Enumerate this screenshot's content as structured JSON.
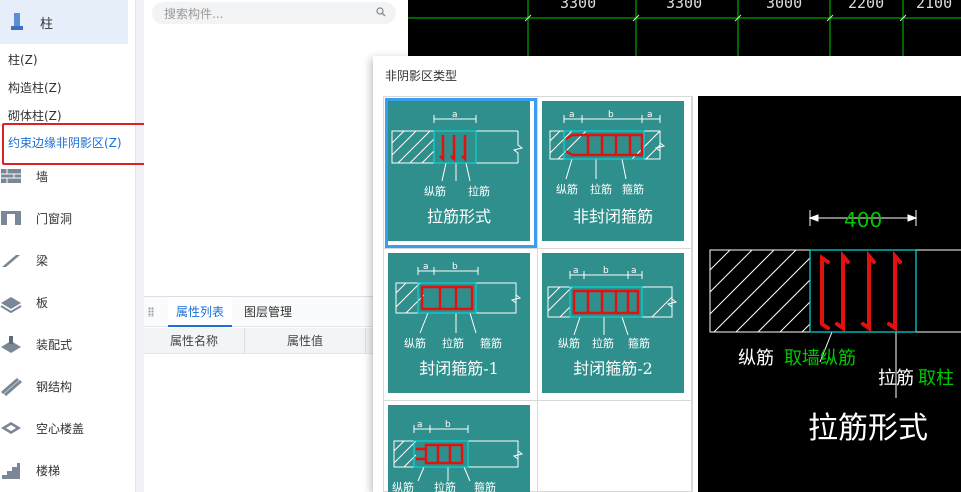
{
  "sidebar": {
    "header": "柱",
    "subitems": [
      "柱(Z)",
      "构造柱(Z)",
      "砌体柱(Z)",
      "约束边缘非阴影区(Z)"
    ],
    "categories": [
      "墙",
      "门窗洞",
      "梁",
      "板",
      "装配式",
      "钢结构",
      "空心楼盖",
      "楼梯"
    ]
  },
  "search": {
    "placeholder": "搜索构件..."
  },
  "panel": {
    "tabs": [
      "属性列表",
      "图层管理"
    ],
    "columns": [
      "属性名称",
      "属性值"
    ]
  },
  "cad": {
    "dimensions": [
      "3300",
      "3300",
      "3000",
      "2200",
      "2100"
    ]
  },
  "dialog": {
    "title": "非阴影区类型",
    "options": [
      {
        "label": "拉筋形式",
        "dim_labels": [
          "a"
        ],
        "callouts": [
          "纵筋",
          "拉筋"
        ]
      },
      {
        "label": "非封闭箍筋",
        "dim_labels": [
          "a",
          "b",
          "a"
        ],
        "callouts": [
          "纵筋",
          "拉筋",
          "箍筋"
        ]
      },
      {
        "label": "封闭箍筋-1",
        "dim_labels": [
          "a",
          "b"
        ],
        "callouts": [
          "纵筋",
          "拉筋",
          "箍筋"
        ]
      },
      {
        "label": "封闭箍筋-2",
        "dim_labels": [
          "a",
          "b",
          "a"
        ],
        "callouts": [
          "纵筋",
          "拉筋",
          "箍筋"
        ]
      },
      {
        "label": "",
        "dim_labels": [
          "a",
          "b"
        ],
        "callouts": [
          "纵筋",
          "拉筋",
          "箍筋"
        ]
      }
    ],
    "preview": {
      "dimension": "400",
      "label_longitudinal": "纵筋",
      "label_wall_rebar": "取墙纵筋",
      "label_tie": "拉筋",
      "label_tie_column": "取柱",
      "caption": "拉筋形式"
    }
  },
  "colors": {
    "teal": "#2e8f8c",
    "accent": "#1a6fd6",
    "highlight": "#e02020",
    "cad_green": "#00c800",
    "cad_cyan": "#00e0e0"
  }
}
